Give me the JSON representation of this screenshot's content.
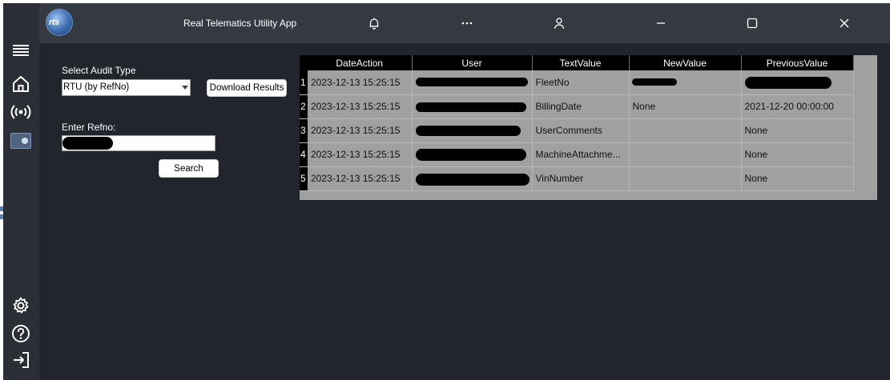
{
  "app": {
    "title": "Real Telematics Utility App",
    "logo_text": "rts"
  },
  "titlebar": {
    "icons": [
      "bell-icon",
      "more-icon",
      "user-icon",
      "minimize-icon",
      "maximize-icon",
      "close-icon"
    ]
  },
  "sidebar": {
    "top_icons": [
      "menu-icon",
      "home-icon",
      "broadcast-icon",
      "rtu-icon"
    ],
    "bottom_icons": [
      "settings-icon",
      "help-icon",
      "logout-icon"
    ]
  },
  "form": {
    "audit_type_label": "Select Audit Type",
    "audit_type_value": "RTU (by RefNo)",
    "download_label": "Download Results",
    "refno_label": "Enter Refno:",
    "search_label": "Search"
  },
  "grid": {
    "columns": [
      "DateAction",
      "User",
      "TextValue",
      "NewValue",
      "PreviousValue"
    ],
    "rows": [
      {
        "index": "1",
        "date_action": "2023-12-13 15:25:15",
        "user": "",
        "text_value": "FleetNo",
        "new_value": "",
        "previous_value": ""
      },
      {
        "index": "2",
        "date_action": "2023-12-13 15:25:15",
        "user": "",
        "text_value": "BillingDate",
        "new_value": "None",
        "previous_value": "2021-12-20 00:00:00"
      },
      {
        "index": "3",
        "date_action": "2023-12-13 15:25:15",
        "user": "",
        "text_value": "UserComments",
        "new_value": "",
        "previous_value": "None"
      },
      {
        "index": "4",
        "date_action": "2023-12-13 15:25:15",
        "user": "",
        "text_value": "MachineAttachme...",
        "new_value": "",
        "previous_value": "None"
      },
      {
        "index": "5",
        "date_action": "2023-12-13 15:25:15",
        "user": "",
        "text_value": "VinNumber",
        "new_value": "",
        "previous_value": "None"
      }
    ]
  },
  "colors": {
    "titlebar": "#353941",
    "sidebar": "#2b2e35",
    "content": "#22252b",
    "grid_cell": "#a0a0a0",
    "grid_header": "#000000"
  }
}
